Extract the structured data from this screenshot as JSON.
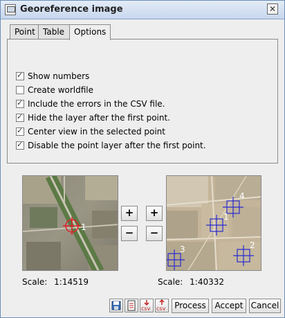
{
  "window": {
    "title": "Georeference image",
    "close_glyph": "✕"
  },
  "tabs": [
    {
      "label": "Point"
    },
    {
      "label": "Table"
    },
    {
      "label": "Options",
      "active": true
    }
  ],
  "options": [
    {
      "label": "Show numbers",
      "checked": true
    },
    {
      "label": "Create worldfile",
      "checked": false
    },
    {
      "label": "Include the errors in the CSV file.",
      "checked": true
    },
    {
      "label": "Hide the layer after the first point.",
      "checked": true
    },
    {
      "label": "Center view in the selected point",
      "checked": true
    },
    {
      "label": "Disable the point layer after the first point.",
      "checked": true
    }
  ],
  "zoom": {
    "plus": "+",
    "minus": "−"
  },
  "left_view": {
    "scale_label": "Scale:",
    "scale_value": "1:14519",
    "points": [
      "1"
    ]
  },
  "right_view": {
    "scale_label": "Scale:",
    "scale_value": "1:40332",
    "points": [
      "1",
      "2",
      "3",
      "4"
    ]
  },
  "toolbar": {
    "icons": [
      "save-icon",
      "document-icon",
      "csv-export-icon",
      "csv-import-icon"
    ],
    "csv_text": "csv",
    "process_label": "Process",
    "accept_label": "Accept",
    "cancel_label": "Cancel"
  },
  "colors": {
    "title_gradient_top": "#e4ecf7",
    "marker_left": "#e0202a",
    "marker_right": "#2a2ad0",
    "window_bg": "#eeeeee"
  }
}
